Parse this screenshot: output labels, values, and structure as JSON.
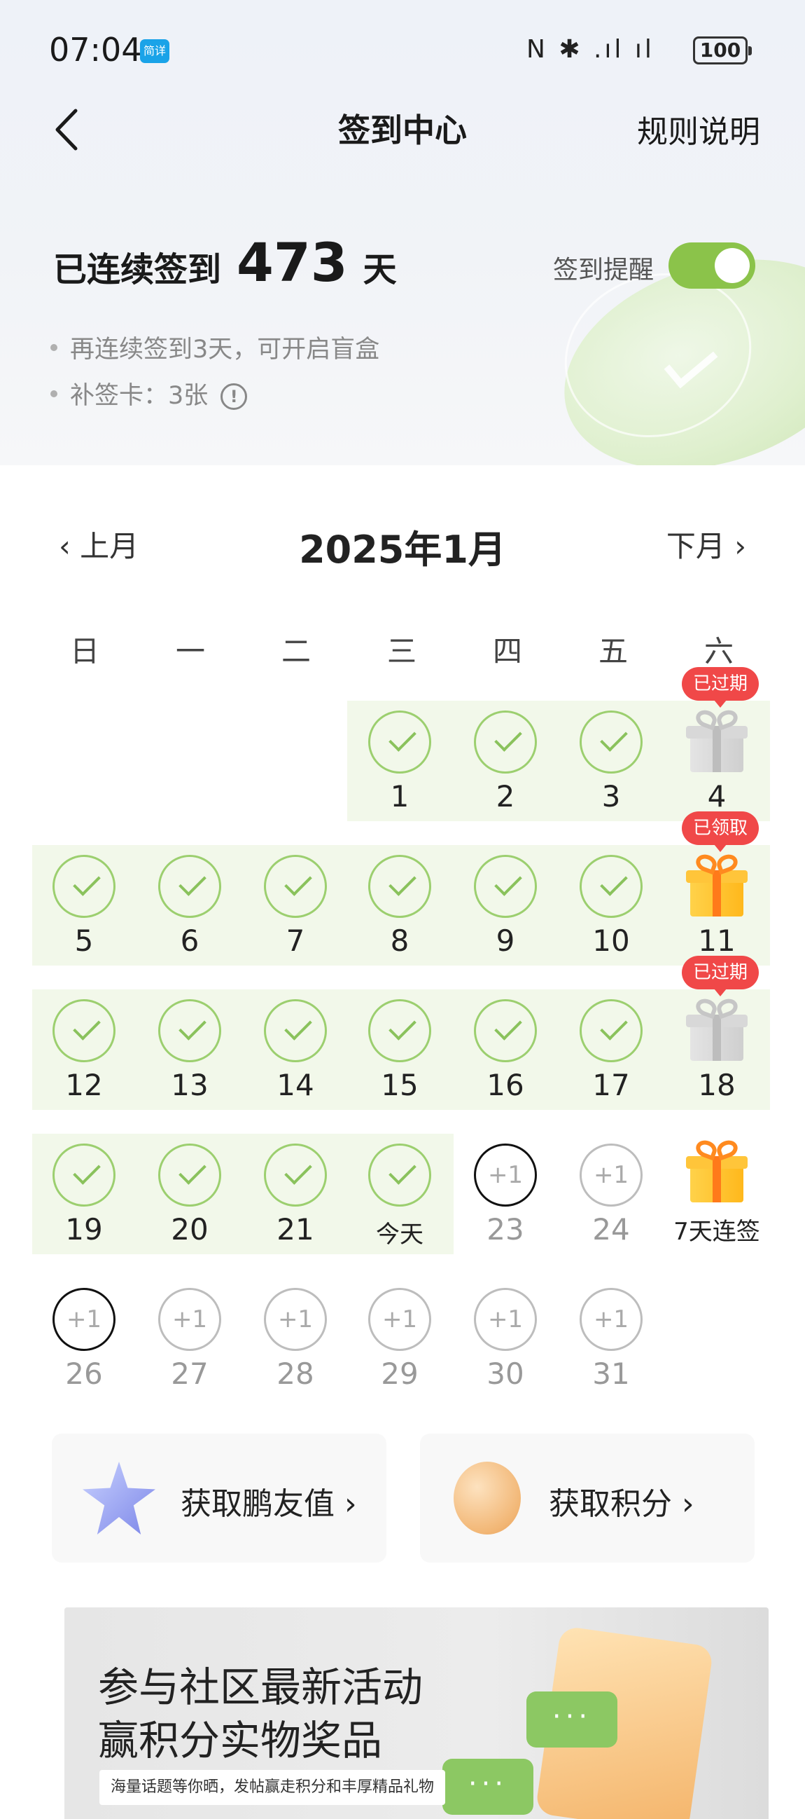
{
  "status_bar": {
    "time": "07:04",
    "badge": "简详",
    "icons": "N ✱ .ıl ıl",
    "battery": "100"
  },
  "nav": {
    "title": "签到中心",
    "rules": "规则说明"
  },
  "streak": {
    "prefix": "已连续签到",
    "days": "473",
    "suffix": "天",
    "reminder_label": "签到提醒",
    "reminder_on": true,
    "notes": [
      "再连续签到3天，可开启盲盒",
      "补签卡：3张"
    ]
  },
  "calendar": {
    "prev": "上月",
    "title": "2025年1月",
    "next": "下月",
    "weekdays": [
      "日",
      "一",
      "二",
      "三",
      "四",
      "五",
      "六"
    ],
    "days": {
      "d1": "1",
      "d2": "2",
      "d3": "3",
      "d4": "4",
      "d5": "5",
      "d6": "6",
      "d7": "7",
      "d8": "8",
      "d9": "9",
      "d10": "10",
      "d11": "11",
      "d12": "12",
      "d13": "13",
      "d14": "14",
      "d15": "15",
      "d16": "16",
      "d17": "17",
      "d18": "18",
      "d19": "19",
      "d20": "20",
      "d21": "21",
      "today": "今天",
      "d23": "23",
      "d24": "24",
      "streak7": "7天连签",
      "d26": "26",
      "d27": "27",
      "d28": "28",
      "d29": "29",
      "d30": "30",
      "d31": "31"
    },
    "plus": "+1",
    "tags": {
      "expired": "已过期",
      "claimed": "已领取"
    }
  },
  "actions": {
    "pengyou": "获取鹏友值 ›",
    "points": "获取积分 ›"
  },
  "banner": {
    "line1": "参与社区最新活动",
    "line2": "赢积分实物奖品",
    "sub": "海量话题等你晒，发帖赢走积分和丰厚精品礼物",
    "bubble": "···"
  },
  "colors": {
    "green": "#8bc34a",
    "tag_red": "#f04848",
    "gold": "#ffb81c"
  }
}
